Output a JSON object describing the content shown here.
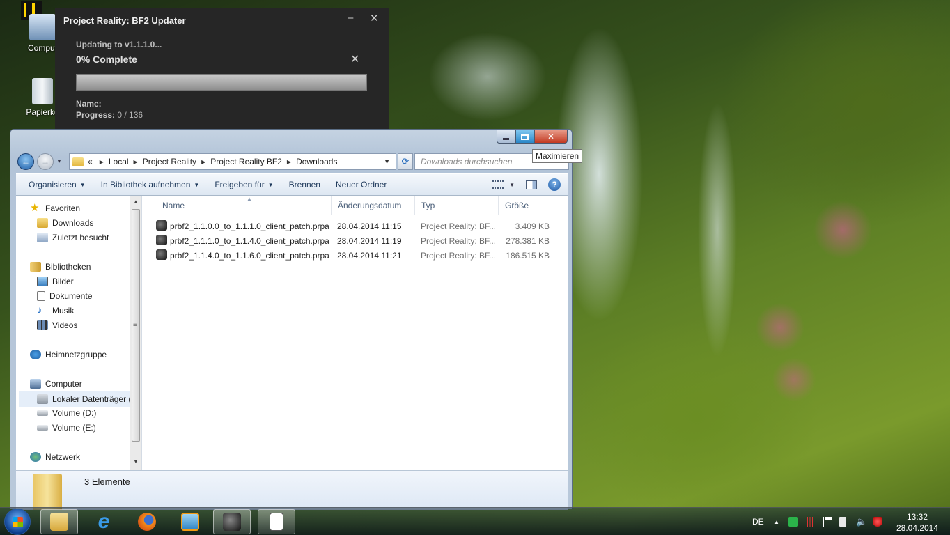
{
  "desktop": {
    "icons": [
      {
        "label": "Comput"
      },
      {
        "label": "Papierko"
      }
    ]
  },
  "updater": {
    "title": "Project Reality: BF2 Updater",
    "minimize_glyph": "–",
    "close_glyph": "✕",
    "status": "Updating to v1.1.1.0...",
    "percent_text": "0% Complete",
    "cancel_glyph": "✕",
    "progress_fraction": 0,
    "name_label": "Name:",
    "name_value": "",
    "progress_label": "Progress:",
    "progress_value": "0 / 136"
  },
  "explorer": {
    "window_title": "",
    "tooltip": "Maximieren",
    "nav": {
      "back_glyph": "←",
      "forward_glyph": "→",
      "dropdown_glyph": "▼"
    },
    "address": {
      "overflow": "«",
      "crumbs": [
        "Local",
        "Project Reality",
        "Project Reality BF2",
        "Downloads"
      ],
      "sep": "▶",
      "dropdown_glyph": "▼",
      "refresh_glyph": "⟳"
    },
    "search_placeholder": "Downloads durchsuchen",
    "toolbar": {
      "organize": "Organisieren",
      "library": "In Bibliothek aufnehmen",
      "share": "Freigeben für",
      "burn": "Brennen",
      "new_folder": "Neuer Ordner",
      "caret": "▼",
      "help": "?"
    },
    "navpane": {
      "favorites": "Favoriten",
      "downloads": "Downloads",
      "recent": "Zuletzt besucht",
      "libraries": "Bibliotheken",
      "pictures": "Bilder",
      "documents": "Dokumente",
      "music": "Musik",
      "videos": "Videos",
      "homegroup": "Heimnetzgruppe",
      "computer": "Computer",
      "local_disk": "Lokaler Datenträger (",
      "vol_d": "Volume (D:)",
      "vol_e": "Volume (E:)",
      "network": "Netzwerk"
    },
    "scroll": {
      "up": "▲",
      "down": "▼",
      "grip": "≡"
    },
    "columns": {
      "name": "Name",
      "date": "Änderungsdatum",
      "type": "Typ",
      "size": "Größe",
      "sort_glyph": "▲"
    },
    "files": [
      {
        "name": "prbf2_1.1.0.0_to_1.1.1.0_client_patch.prpa...",
        "date": "28.04.2014 11:15",
        "type": "Project Reality: BF...",
        "size": "3.409 KB"
      },
      {
        "name": "prbf2_1.1.1.0_to_1.1.4.0_client_patch.prpa...",
        "date": "28.04.2014 11:19",
        "type": "Project Reality: BF...",
        "size": "278.381 KB"
      },
      {
        "name": "prbf2_1.1.4.0_to_1.1.6.0_client_patch.prpa...",
        "date": "28.04.2014 11:21",
        "type": "Project Reality: BF...",
        "size": "186.515 KB"
      }
    ],
    "item_count": "3 Elemente"
  },
  "taskbar": {
    "language": "DE",
    "tray_arrow": "▲",
    "time": "13:32",
    "date": "28.04.2014"
  },
  "colors": {
    "updater_bg": "#262626",
    "progress_green": "#3f8e2f",
    "explorer_frame": "#b3c4d8",
    "close_red": "#c23a22",
    "max_blue": "#2b87c8"
  }
}
